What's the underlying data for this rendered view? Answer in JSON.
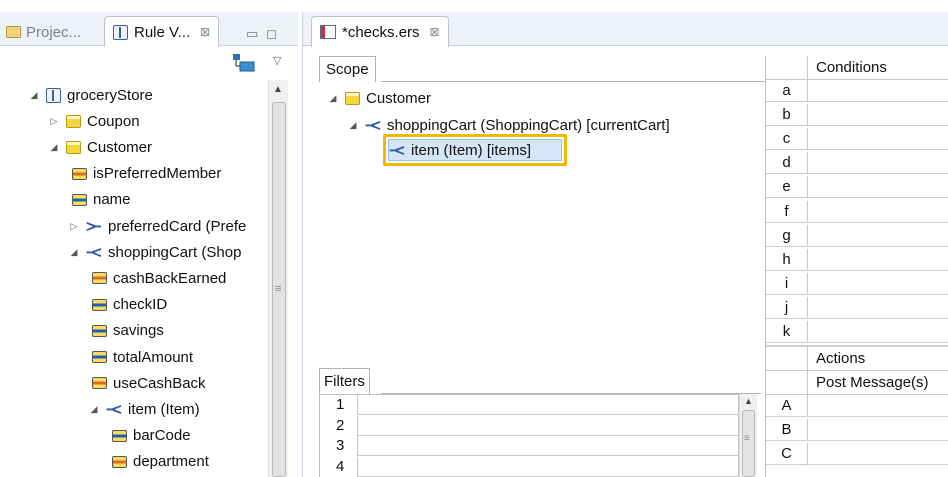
{
  "left_panel": {
    "tabs": [
      {
        "label": "Projec...",
        "active": false
      },
      {
        "label": "Rule V...",
        "active": true
      }
    ],
    "close_glyph": "⊠",
    "tree": [
      {
        "label": "groceryStore",
        "indent": 0,
        "twisty": "expanded",
        "icon": "vocabulary-icon"
      },
      {
        "label": "Coupon",
        "indent": 1,
        "twisty": "collapsed",
        "icon": "entity-icon"
      },
      {
        "label": "Customer",
        "indent": 1,
        "twisty": "expanded",
        "icon": "entity-icon"
      },
      {
        "label": "isPreferredMember",
        "indent": 2,
        "twisty": "",
        "icon": "attribute-orange-icon"
      },
      {
        "label": "name",
        "indent": 2,
        "twisty": "",
        "icon": "attribute-blue-icon"
      },
      {
        "label": "preferredCard (Prefe",
        "indent": 2,
        "twisty": "collapsed",
        "icon": "association-one-icon"
      },
      {
        "label": "shoppingCart (Shop",
        "indent": 2,
        "twisty": "expanded",
        "icon": "association-many-icon"
      },
      {
        "label": "cashBackEarned",
        "indent": 3,
        "twisty": "",
        "icon": "attribute-orange-icon"
      },
      {
        "label": "checkID",
        "indent": 3,
        "twisty": "",
        "icon": "attribute-blue-icon"
      },
      {
        "label": "savings",
        "indent": 3,
        "twisty": "",
        "icon": "attribute-blue-icon"
      },
      {
        "label": "totalAmount",
        "indent": 3,
        "twisty": "",
        "icon": "attribute-blue-icon"
      },
      {
        "label": "useCashBack",
        "indent": 3,
        "twisty": "",
        "icon": "attribute-orange-icon"
      },
      {
        "label": "item (Item)",
        "indent": 3,
        "twisty": "expanded",
        "icon": "association-many-icon"
      },
      {
        "label": "barCode",
        "indent": 4,
        "twisty": "",
        "icon": "attribute-blue-icon"
      },
      {
        "label": "department",
        "indent": 4,
        "twisty": "",
        "icon": "attribute-orange-icon"
      }
    ]
  },
  "editor": {
    "tab_label": "*checks.ers",
    "scope": {
      "tab_label": "Scope",
      "nodes": [
        {
          "label": "Customer",
          "indent": 0,
          "twisty": "expanded",
          "icon": "entity-icon"
        },
        {
          "label": "shoppingCart (ShoppingCart) [currentCart]",
          "indent": 1,
          "twisty": "expanded",
          "icon": "association-many-icon"
        },
        {
          "label": "item (Item) [items]",
          "indent": 2,
          "twisty": "",
          "icon": "association-many-icon",
          "selected": true
        }
      ]
    },
    "filters": {
      "tab_label": "Filters",
      "rows": [
        "1",
        "2",
        "3",
        "4"
      ]
    },
    "conditions": {
      "header": "Conditions",
      "rows": [
        "a",
        "b",
        "c",
        "d",
        "e",
        "f",
        "g",
        "h",
        "i",
        "j",
        "k"
      ]
    },
    "actions": {
      "header": "Actions",
      "post_header": "Post Message(s)",
      "rows": [
        "A",
        "B",
        "C"
      ]
    }
  },
  "colors": {
    "highlight": "#f5b800",
    "selection": "#d4e6f8",
    "tabbar": "#eef2f8"
  }
}
